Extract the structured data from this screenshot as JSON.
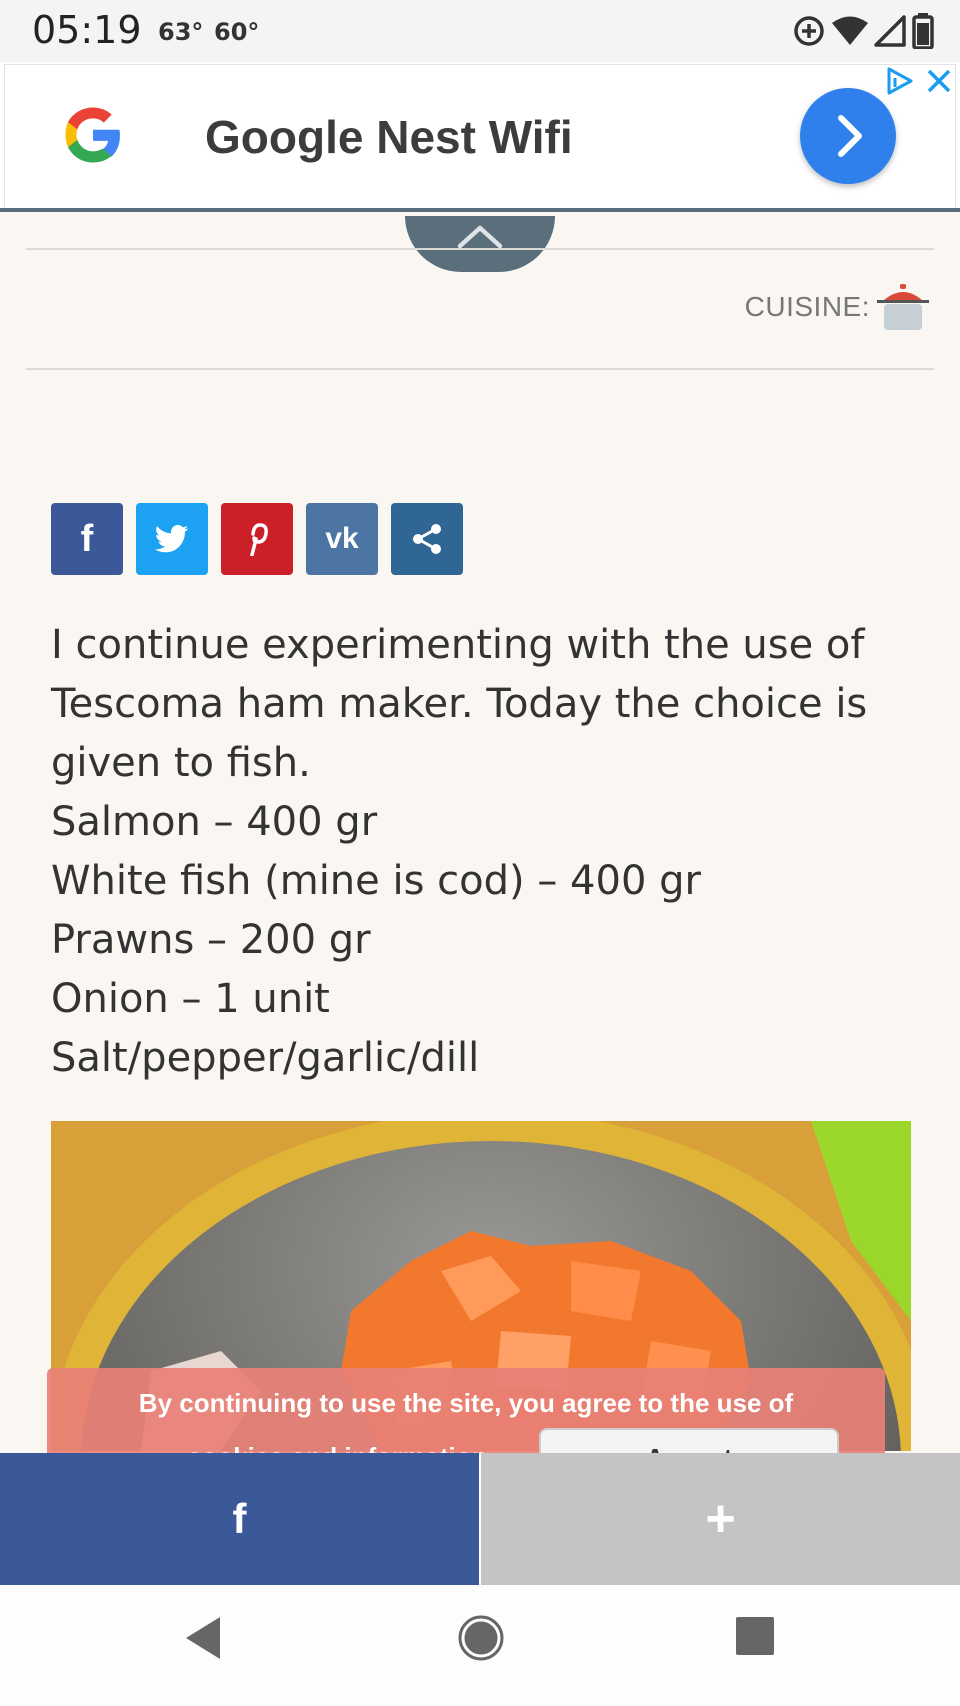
{
  "status_bar": {
    "time": "05:19",
    "temp_1": "63°",
    "temp_2": "60°",
    "icons": [
      "data-saver-icon",
      "wifi-icon",
      "signal-icon",
      "battery-icon"
    ]
  },
  "ad": {
    "title": "Google Nest Wifi",
    "brand_colors": {
      "cta": "#2f80ec",
      "adchoices": "#1a9cf0"
    }
  },
  "cuisine": {
    "label": "CUISINE:"
  },
  "share_buttons": [
    {
      "name": "facebook",
      "glyph": "f",
      "color": "#3b5998"
    },
    {
      "name": "twitter",
      "color": "#1da1f2"
    },
    {
      "name": "pinterest",
      "glyph": "P",
      "color": "#cb2027"
    },
    {
      "name": "vk",
      "glyph": "vk",
      "color": "#4c75a3"
    },
    {
      "name": "share",
      "color": "#2f6694"
    }
  ],
  "article": {
    "intro": "I continue experimenting with the use of Tescoma ham maker. Today the choice is given to fish.",
    "ingredients": [
      "Salmon – 400 gr",
      "White fish (mine is cod) – 400 gr",
      "Prawns – 200 gr",
      "Onion – 1 unit",
      "Salt/pepper/garlic/dill"
    ]
  },
  "cookie_notice": {
    "text": "By continuing to use the site, you agree to the use of",
    "text_2": "cookies and information",
    "accept_label": "Accept"
  },
  "bottom_bar": {
    "facebook_glyph": "f",
    "more_glyph": "+"
  }
}
